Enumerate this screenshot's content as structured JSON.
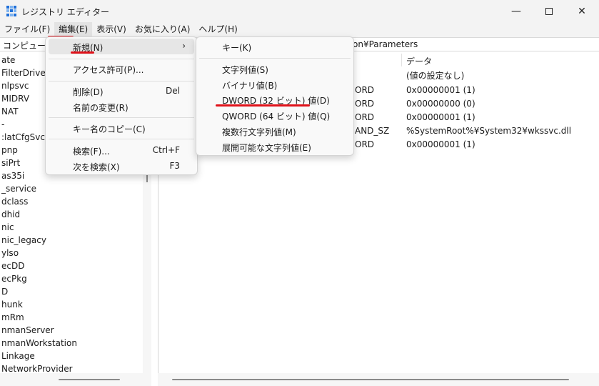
{
  "window": {
    "title": "レジストリ エディター"
  },
  "menubar": [
    "ファイル(F)",
    "編集(E)",
    "表示(V)",
    "お気に入り(A)",
    "ヘルプ(H)"
  ],
  "address": {
    "root": "コンピューター",
    "path_tail": "on¥Parameters"
  },
  "tree": [
    "ate",
    "FilterDriver",
    "nlpsvc",
    "MIDRV",
    "NAT",
    "-",
    ":latCfgSvc",
    "pnp",
    "siPrt",
    "as35i",
    "_service",
    "dclass",
    "dhid",
    "nic",
    "nic_legacy",
    "ylso",
    "ecDD",
    "ecPkg",
    "D",
    "hunk",
    "mRm",
    "nmanServer",
    "nmanWorkstation",
    "Linkage",
    "NetworkProvider"
  ],
  "values": {
    "column_data": "データ",
    "rows": [
      {
        "type": "",
        "data": "(値の設定なし)"
      },
      {
        "type": "ORD",
        "data": "0x00000001 (1)"
      },
      {
        "type": "ORD",
        "data": "0x00000000 (0)"
      },
      {
        "type": "ORD",
        "data": "0x00000001 (1)"
      },
      {
        "type": "AND_SZ",
        "data": "%SystemRoot%¥System32¥wkssvc.dll"
      },
      {
        "type": "ORD",
        "data": "0x00000001 (1)"
      }
    ]
  },
  "edit_menu": {
    "items": [
      {
        "label": "新規(N)",
        "shortcut": "",
        "arrow": "›"
      },
      {
        "label": "アクセス許可(P)...",
        "shortcut": "",
        "arrow": ""
      },
      {
        "label": "削除(D)",
        "shortcut": "Del",
        "arrow": ""
      },
      {
        "label": "名前の変更(R)",
        "shortcut": "",
        "arrow": ""
      },
      {
        "label": "キー名のコピー(C)",
        "shortcut": "",
        "arrow": ""
      },
      {
        "label": "検索(F)...",
        "shortcut": "Ctrl+F",
        "arrow": ""
      },
      {
        "label": "次を検索(X)",
        "shortcut": "F3",
        "arrow": ""
      }
    ]
  },
  "new_menu": {
    "items": [
      {
        "label": "キー(K)"
      },
      {
        "label": "文字列値(S)"
      },
      {
        "label": "バイナリ値(B)"
      },
      {
        "label": "DWORD (32 ビット) 値(D)"
      },
      {
        "label": "QWORD (64 ビット) 値(Q)"
      },
      {
        "label": "複数行文字列値(M)"
      },
      {
        "label": "展開可能な文字列値(E)"
      }
    ]
  },
  "colors": {
    "annotation": "#e0121a",
    "accent": "#1e6fd9"
  }
}
